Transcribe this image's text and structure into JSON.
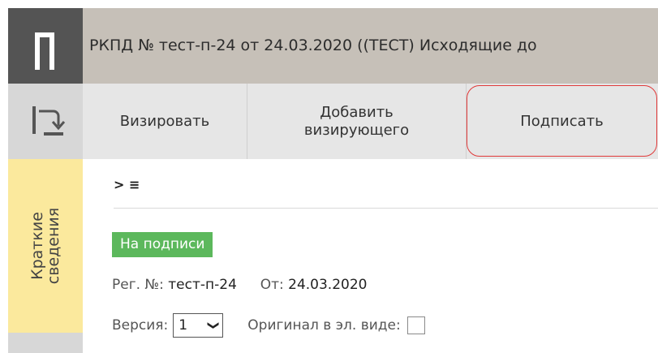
{
  "app": {
    "logo_letter": "П",
    "title": "РКПД №  тест-п-24 от 24.03.2020 ((ТЕСТ) Исходящие до"
  },
  "toolbar": {
    "visa_label": "Визировать",
    "add_approver_line1": "Добавить",
    "add_approver_line2": "визирующего",
    "sign_label": "Подписать"
  },
  "side_tab": {
    "line1": "Краткие",
    "line2": "сведения"
  },
  "content": {
    "toggle_text": "> ≡",
    "status_badge": "На подписи",
    "reg_label": "Рег. №:",
    "reg_value": "тест-п-24",
    "date_label": "От:",
    "date_value": "24.03.2020",
    "version_label": "Версия:",
    "version_value": "1",
    "original_label": "Оригинал в эл. виде:"
  },
  "colors": {
    "status_green": "#5cb85c",
    "highlight_red": "#e03a3a",
    "side_tab_yellow": "#fbe99d"
  }
}
